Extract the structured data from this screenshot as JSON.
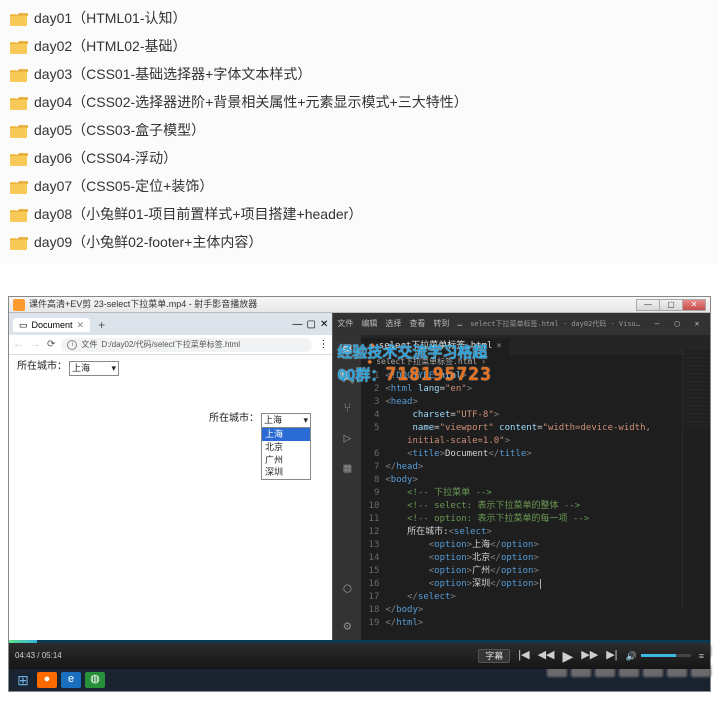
{
  "folders": [
    {
      "label": "day01（HTML01-认知）"
    },
    {
      "label": "day02（HTML02-基础）"
    },
    {
      "label": "day03（CSS01-基础选择器+字体文本样式）"
    },
    {
      "label": "day04（CSS02-选择器进阶+背景相关属性+元素显示模式+三大特性）"
    },
    {
      "label": "day05（CSS03-盒子模型）"
    },
    {
      "label": "day06（CSS04-浮动）"
    },
    {
      "label": "day07（CSS05-定位+装饰）"
    },
    {
      "label": "day08（小兔鲜01-项目前置样式+项目搭建+header）"
    },
    {
      "label": "day09（小兔鲜02-footer+主体内容）"
    }
  ],
  "player_title": "课件高清+EV剪 23-select下拉菜单.mp4 - 射手影音播放器",
  "browser": {
    "tab_title": "Document",
    "url_prefix": "文件",
    "url": "D:/day02/代码/select下拉菜单标签.html"
  },
  "page": {
    "field_label": "所在城市：",
    "selected": "上海",
    "options": [
      "上海",
      "北京",
      "广州",
      "深圳"
    ]
  },
  "watermark": {
    "line1": "经验技术交流学习格超",
    "line2_label": "QQ群：",
    "line2_num": "718195723"
  },
  "vscode": {
    "menu": [
      "文件",
      "编辑",
      "选择",
      "查看",
      "转到",
      "…"
    ],
    "window_title": "select下拉菜单标签.html - day02代码 - Visu…",
    "tab": "select下拉菜单标签.html",
    "breadcrumb": "select下拉菜单标签.html",
    "code": {
      "l1a": "<!",
      "l1b": "DOCTYPE",
      "l1c": " html",
      "l1d": ">",
      "l2a": "<",
      "l2b": "html",
      "l2c": " lang",
      "l2d": "=",
      "l2e": "\"en\"",
      "l2f": ">",
      "l3a": "<",
      "l3b": "head",
      "l3c": ">",
      "l4c": " charset",
      "l4e": "\"UTF-8\"",
      "l4f": ">",
      "l5c": " name",
      "l5e": "\"viewport\"",
      "l5f": " content",
      "l5g": "=",
      "l5h": "\"width=device-width,",
      "l5i": "initial-scale=1.0\"",
      "l5j": ">",
      "l6a": "<",
      "l6b": "title",
      "l6c": ">",
      "l6d": "Document",
      "l6e": "</",
      "l6f": "title",
      "l6g": ">",
      "l7a": "</",
      "l7b": "head",
      "l7c": ">",
      "l8a": "<",
      "l8b": "body",
      "l8c": ">",
      "l9": "<!-- 下拉菜单 -->",
      "l10": "<!-- select: 表示下拉菜单的整体 -->",
      "l11": "<!-- option: 表示下拉菜单的每一项 -->",
      "l12a": "所在城市:",
      "l12b": "<",
      "l12c": "select",
      "l12d": ">",
      "opt_open_a": "<",
      "opt_open_b": "option",
      "opt_open_c": ">",
      "opt_close_a": "</",
      "opt_close_b": "option",
      "opt_close_c": ">",
      "o1": "上海",
      "o2": "北京",
      "o3": "广州",
      "o4": "深圳",
      "l17a": "</",
      "l17b": "select",
      "l17c": ">",
      "l18a": "</",
      "l18b": "body",
      "l18c": ">",
      "l19a": "</",
      "l19b": "html",
      "l19c": ">"
    }
  },
  "controls": {
    "time_current": "04:43",
    "time_total": "05:14",
    "subtitle": "字幕"
  }
}
